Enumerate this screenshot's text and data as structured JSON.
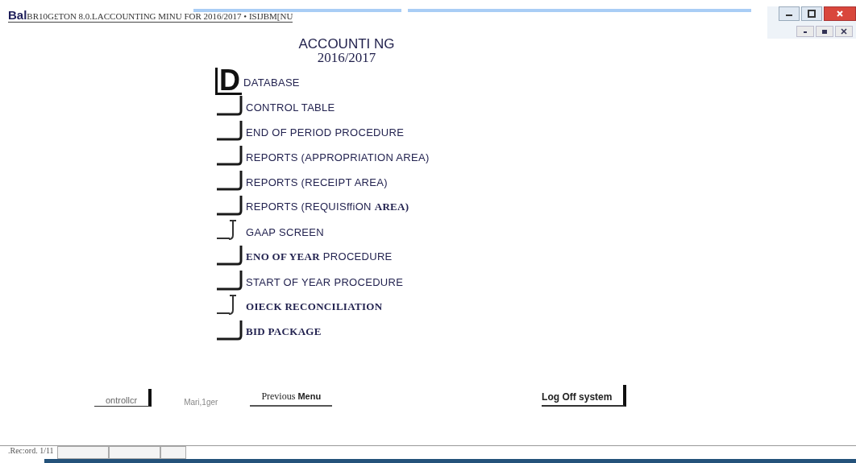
{
  "window": {
    "title_prefix": "Bal",
    "title": "BR10G£TON 8.0.LACCOUNTING MINU FOR 2016/2017 • ISIJBM[NU"
  },
  "heading": {
    "line_1": "ACCOUNTI NG",
    "line_2": "2016/2017"
  },
  "menu_items": [
    {
      "kind": "letter",
      "glyph": "D",
      "label": "DATABASE",
      "serif": false
    },
    {
      "kind": "bracket",
      "label": "CONTROL TABLE",
      "serif": false
    },
    {
      "kind": "bracket",
      "label": "END OF PERIOD PROCEDURE",
      "serif": false
    },
    {
      "kind": "bracket",
      "label": "REPORTS (APPROPRIATION AREA)",
      "serif": false
    },
    {
      "kind": "bracket",
      "label": "REPORTS (RECEIPT AREA)",
      "serif": false
    },
    {
      "kind": "bracket",
      "label": "REPORTS (REQUISffiON **AREA)**",
      "serif": false
    },
    {
      "kind": "hook",
      "label": "GAAP SCREEN",
      "serif": false
    },
    {
      "kind": "bracket",
      "label": "**ENO OF YEAR** PROCEDURE",
      "serif": false
    },
    {
      "kind": "bracket",
      "label": "START OF YEAR PROCEDURE",
      "serif": false
    },
    {
      "kind": "hook",
      "label": "OIECK RECONCILIATION",
      "serif": true
    },
    {
      "kind": "bracket",
      "label": "BID PACKAGE",
      "serif": true
    }
  ],
  "footer_links": [
    {
      "kind": "link",
      "label": "ontrollcr",
      "bar": true
    },
    {
      "kind": "muted",
      "label": "Mari,1ger",
      "bar": false
    },
    {
      "kind": "link",
      "label": "Previous **Menu**",
      "bar": false
    },
    {
      "kind": "bold",
      "label": "Log Off system",
      "bar": true
    }
  ],
  "status_bar": {
    "record": ".Rec:ord. 1/11"
  }
}
